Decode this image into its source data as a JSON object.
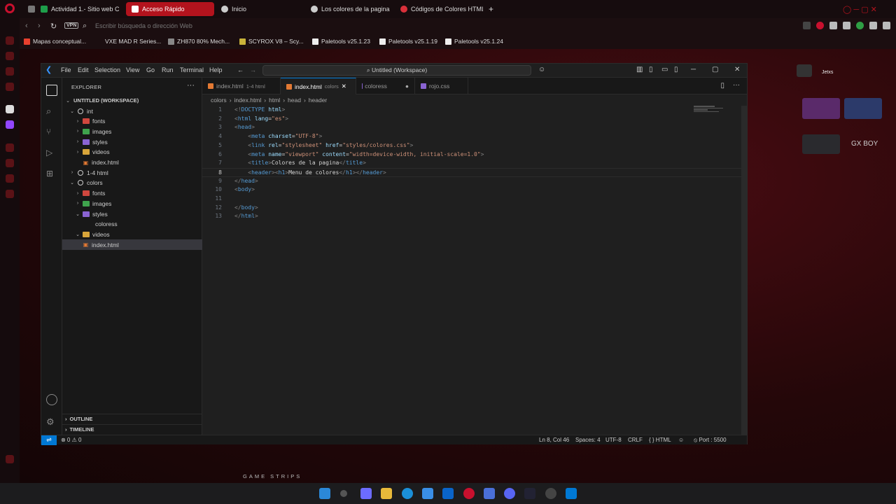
{
  "browser": {
    "tabs": [
      {
        "label": "Actividad 1.- Sitio web Co",
        "icon_color": "#1e9e4a"
      },
      {
        "label": "Acceso Rápido",
        "icon_color": "#ffffff",
        "active": true
      },
      {
        "label": "Inicio",
        "icon_color": "#cccccc"
      },
      {
        "label": "Los colores de la pagina",
        "icon_color": "#cccccc"
      },
      {
        "label": "Códigos de Colores HTML",
        "icon_color": "#d9303a"
      }
    ],
    "new_tab": "+",
    "vpn_label": "VPN",
    "address_placeholder": "Escribir búsqueda o dirección Web",
    "bookmarks": [
      "Mapas conceptual...",
      "VXE MAD R Series...",
      "ZH870 80% Mech...",
      "SCYROX V8 – Scy...",
      "Paletools v25.1.23",
      "Paletools v25.1.19",
      "Paletools v25.1.24"
    ],
    "accent_color": "#b3131d"
  },
  "stream_overlay": {
    "name_label": "Jetxs",
    "brand_label": "GX BOY",
    "footer_label": "GAME STRIPS"
  },
  "vscode": {
    "menu": [
      "File",
      "Edit",
      "Selection",
      "View",
      "Go",
      "Run",
      "Terminal",
      "Help"
    ],
    "search_label": "Untitled (Workspace)",
    "explorer_title": "EXPLORER",
    "workspace_label": "UNTITLED (WORKSPACE)",
    "tree": [
      {
        "label": "int",
        "kind": "root",
        "open": true,
        "depth": 0
      },
      {
        "label": "fonts",
        "kind": "folder",
        "open": false,
        "depth": 1,
        "color": "#d0473e"
      },
      {
        "label": "images",
        "kind": "folder",
        "open": false,
        "depth": 1,
        "color": "#3fa34d"
      },
      {
        "label": "styles",
        "kind": "folder",
        "open": false,
        "depth": 1,
        "color": "#8a63d2"
      },
      {
        "label": "videos",
        "kind": "folder",
        "open": false,
        "depth": 1,
        "color": "#d8a53a"
      },
      {
        "label": "index.html",
        "kind": "file",
        "depth": 1
      },
      {
        "label": "1-4 html",
        "kind": "root",
        "open": false,
        "depth": 0
      },
      {
        "label": "colors",
        "kind": "root",
        "open": true,
        "depth": 0
      },
      {
        "label": "fonts",
        "kind": "folder",
        "open": false,
        "depth": 1,
        "color": "#d0473e"
      },
      {
        "label": "images",
        "kind": "folder",
        "open": false,
        "depth": 1,
        "color": "#3fa34d"
      },
      {
        "label": "styles",
        "kind": "folder",
        "open": true,
        "depth": 1,
        "color": "#8a63d2"
      },
      {
        "label": "coloress",
        "kind": "plain",
        "depth": 2
      },
      {
        "label": "videos",
        "kind": "folder",
        "open": true,
        "depth": 1,
        "color": "#d8a53a"
      },
      {
        "label": "index.html",
        "kind": "file",
        "depth": 1,
        "selected": true
      }
    ],
    "outline_label": "OUTLINE",
    "timeline_label": "TIMELINE",
    "tabs": [
      {
        "label": "index.html",
        "sub": "1-4 html"
      },
      {
        "label": "index.html",
        "sub": "colors",
        "active": true,
        "close": "✕"
      },
      {
        "label": "coloress",
        "dot": "●"
      },
      {
        "label": "rojo.css"
      }
    ],
    "breadcrumb": [
      "colors",
      "index.html",
      "html",
      "head",
      "header"
    ],
    "code_lines": [
      [
        [
          "tg",
          "<!"
        ],
        [
          "tn",
          "DOCTYPE"
        ],
        [
          "tx",
          " "
        ],
        [
          "at",
          "html"
        ],
        [
          "tg",
          ">"
        ]
      ],
      [
        [
          "tg",
          "<"
        ],
        [
          "tn",
          "html"
        ],
        [
          "tx",
          " "
        ],
        [
          "at",
          "lang"
        ],
        [
          "tx",
          "="
        ],
        [
          "sv",
          "\"es\""
        ],
        [
          "tg",
          ">"
        ]
      ],
      [
        [
          "tg",
          "<"
        ],
        [
          "tn",
          "head"
        ],
        [
          "tg",
          ">"
        ]
      ],
      [
        [
          "tx",
          "    "
        ],
        [
          "tg",
          "<"
        ],
        [
          "tn",
          "meta"
        ],
        [
          "tx",
          " "
        ],
        [
          "at",
          "charset"
        ],
        [
          "tx",
          "="
        ],
        [
          "sv",
          "\"UTF-8\""
        ],
        [
          "tg",
          ">"
        ]
      ],
      [
        [
          "tx",
          "    "
        ],
        [
          "tg",
          "<"
        ],
        [
          "tn",
          "link"
        ],
        [
          "tx",
          " "
        ],
        [
          "at",
          "rel"
        ],
        [
          "tx",
          "="
        ],
        [
          "sv",
          "\"stylesheet\""
        ],
        [
          "tx",
          " "
        ],
        [
          "at",
          "href"
        ],
        [
          "tx",
          "="
        ],
        [
          "sv",
          "\"styles/colores.css\""
        ],
        [
          "tg",
          ">"
        ]
      ],
      [
        [
          "tx",
          "    "
        ],
        [
          "tg",
          "<"
        ],
        [
          "tn",
          "meta"
        ],
        [
          "tx",
          " "
        ],
        [
          "at",
          "name"
        ],
        [
          "tx",
          "="
        ],
        [
          "sv",
          "\"viewport\""
        ],
        [
          "tx",
          " "
        ],
        [
          "at",
          "content"
        ],
        [
          "tx",
          "="
        ],
        [
          "sv",
          "\"width=device-width, initial-scale=1.0\""
        ],
        [
          "tg",
          ">"
        ]
      ],
      [
        [
          "tx",
          "    "
        ],
        [
          "tg",
          "<"
        ],
        [
          "tn",
          "title"
        ],
        [
          "tg",
          ">"
        ],
        [
          "tx",
          "Colores de la pagina"
        ],
        [
          "tg",
          "</"
        ],
        [
          "tn",
          "title"
        ],
        [
          "tg",
          ">"
        ]
      ],
      [
        [
          "tx",
          "    "
        ],
        [
          "tg",
          "<"
        ],
        [
          "tn",
          "header"
        ],
        [
          "tg",
          "><"
        ],
        [
          "tn",
          "h1"
        ],
        [
          "tg",
          ">"
        ],
        [
          "tx",
          "Menu de colores"
        ],
        [
          "tg",
          "</"
        ],
        [
          "tn",
          "h1"
        ],
        [
          "tg",
          "></"
        ],
        [
          "tn",
          "header"
        ],
        [
          "tg",
          ">"
        ]
      ],
      [
        [
          "tg",
          "</"
        ],
        [
          "tn",
          "head"
        ],
        [
          "tg",
          ">"
        ]
      ],
      [
        [
          "tg",
          "<"
        ],
        [
          "tn",
          "body"
        ],
        [
          "tg",
          ">"
        ]
      ],
      [
        [
          "tx",
          ""
        ]
      ],
      [
        [
          "tg",
          "</"
        ],
        [
          "tn",
          "body"
        ],
        [
          "tg",
          ">"
        ]
      ],
      [
        [
          "tg",
          "</"
        ],
        [
          "tn",
          "html"
        ],
        [
          "tg",
          ">"
        ]
      ]
    ],
    "current_line": 8,
    "status": {
      "errors": "⊗ 0 ⚠ 0",
      "position": "Ln 8, Col 46",
      "spaces": "Spaces: 4",
      "encoding": "UTF-8",
      "eol": "CRLF",
      "language": "{ } HTML",
      "port": "⦸ Port : 5500"
    }
  }
}
